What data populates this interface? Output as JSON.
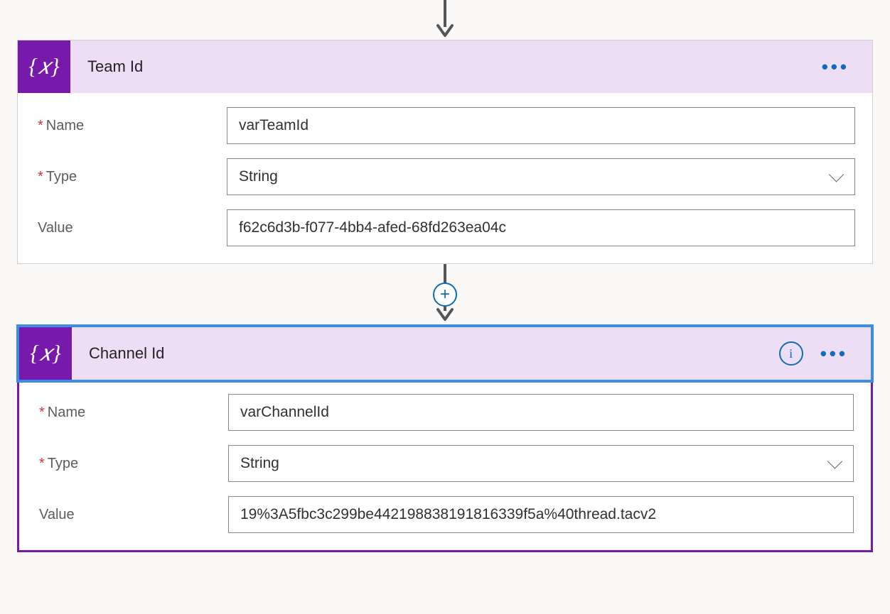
{
  "cards": [
    {
      "title": "Team Id",
      "selected": false,
      "showInfo": false,
      "fields": {
        "name": {
          "label": "Name",
          "required": true,
          "value": "varTeamId"
        },
        "type": {
          "label": "Type",
          "required": true,
          "value": "String"
        },
        "value": {
          "label": "Value",
          "required": false,
          "value": "f62c6d3b-f077-4bb4-afed-68fd263ea04c"
        }
      }
    },
    {
      "title": "Channel Id",
      "selected": true,
      "showInfo": true,
      "fields": {
        "name": {
          "label": "Name",
          "required": true,
          "value": "varChannelId"
        },
        "type": {
          "label": "Type",
          "required": true,
          "value": "String"
        },
        "value": {
          "label": "Value",
          "required": false,
          "value": "19%3A5fbc3c299be44219883819181­6339f5a%40thread.tacv2"
        }
      }
    }
  ],
  "infoGlyph": "i",
  "ellipsis": "•••",
  "plus": "+",
  "variableGlyph": "{𝑥}"
}
